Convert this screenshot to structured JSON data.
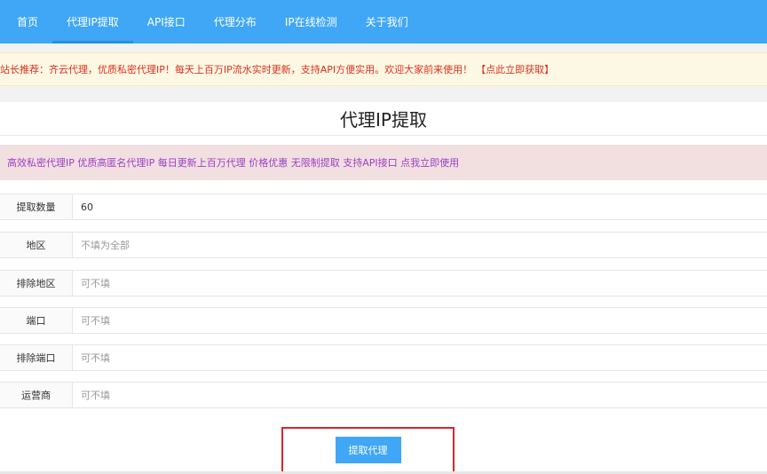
{
  "nav": {
    "items": [
      {
        "label": "首页"
      },
      {
        "label": "代理IP提取"
      },
      {
        "label": "API接口"
      },
      {
        "label": "代理分布"
      },
      {
        "label": "IP在线检测"
      },
      {
        "label": "关于我们"
      }
    ]
  },
  "notice": {
    "text": "站长推荐：齐云代理，优质私密代理IP！每天上百万IP流水实时更新，支持API方便实用。欢迎大家前来使用！",
    "link": "【点此立即获取】"
  },
  "page": {
    "title": "代理IP提取",
    "promo": "高效私密代理IP 优质高匿名代理IP 每日更新上百万代理 价格优惠 无限制提取 支持API接口 点我立即使用"
  },
  "form": {
    "fields": [
      {
        "label": "提取数量",
        "value": "60",
        "placeholder": ""
      },
      {
        "label": "地区",
        "value": "",
        "placeholder": "不填为全部"
      },
      {
        "label": "排除地区",
        "value": "",
        "placeholder": "可不填"
      },
      {
        "label": "端口",
        "value": "",
        "placeholder": "可不填"
      },
      {
        "label": "排除端口",
        "value": "",
        "placeholder": "可不填"
      },
      {
        "label": "运营商",
        "value": "",
        "placeholder": "可不填"
      }
    ],
    "submit_label": "提取代理"
  }
}
